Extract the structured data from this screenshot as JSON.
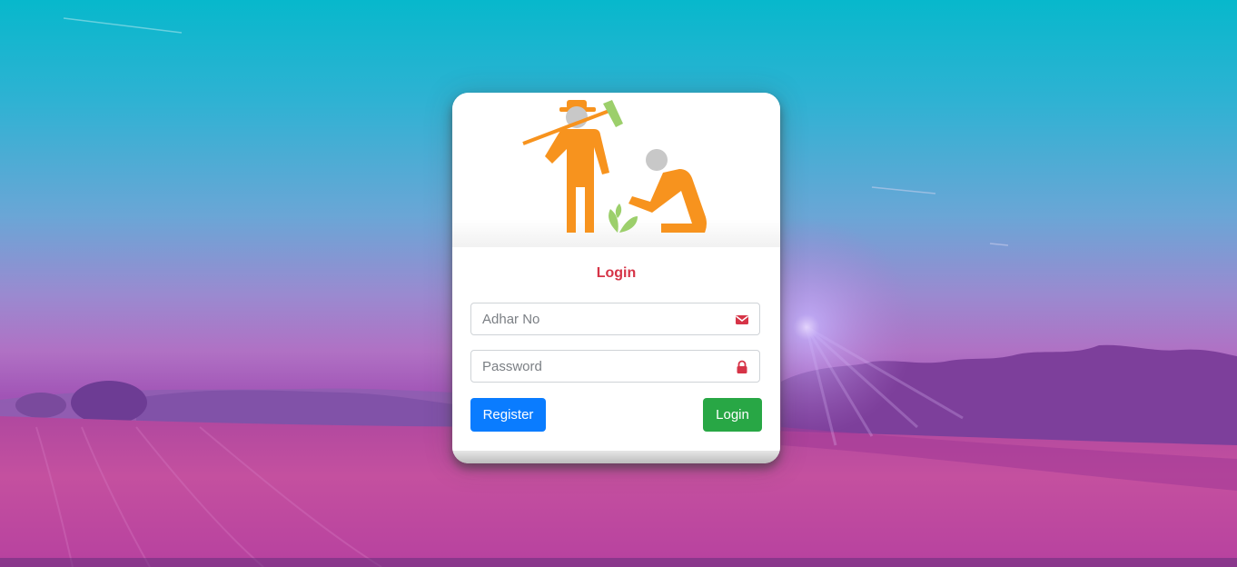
{
  "login_card": {
    "title": "Login",
    "adhar_placeholder": "Adhar No",
    "password_placeholder": "Password",
    "register_label": "Register",
    "login_label": "Login"
  },
  "icons": {
    "adhar": "envelope-icon",
    "password": "lock-icon",
    "logo": "farmers-logo-icon"
  },
  "colors": {
    "title": "#d63447",
    "icon": "#d63447",
    "register_button": "#0a7cff",
    "login_button": "#28a745",
    "logo_figure": "#f7931e",
    "logo_head": "#c8c8c8",
    "logo_plant": "#9ccf6b"
  }
}
